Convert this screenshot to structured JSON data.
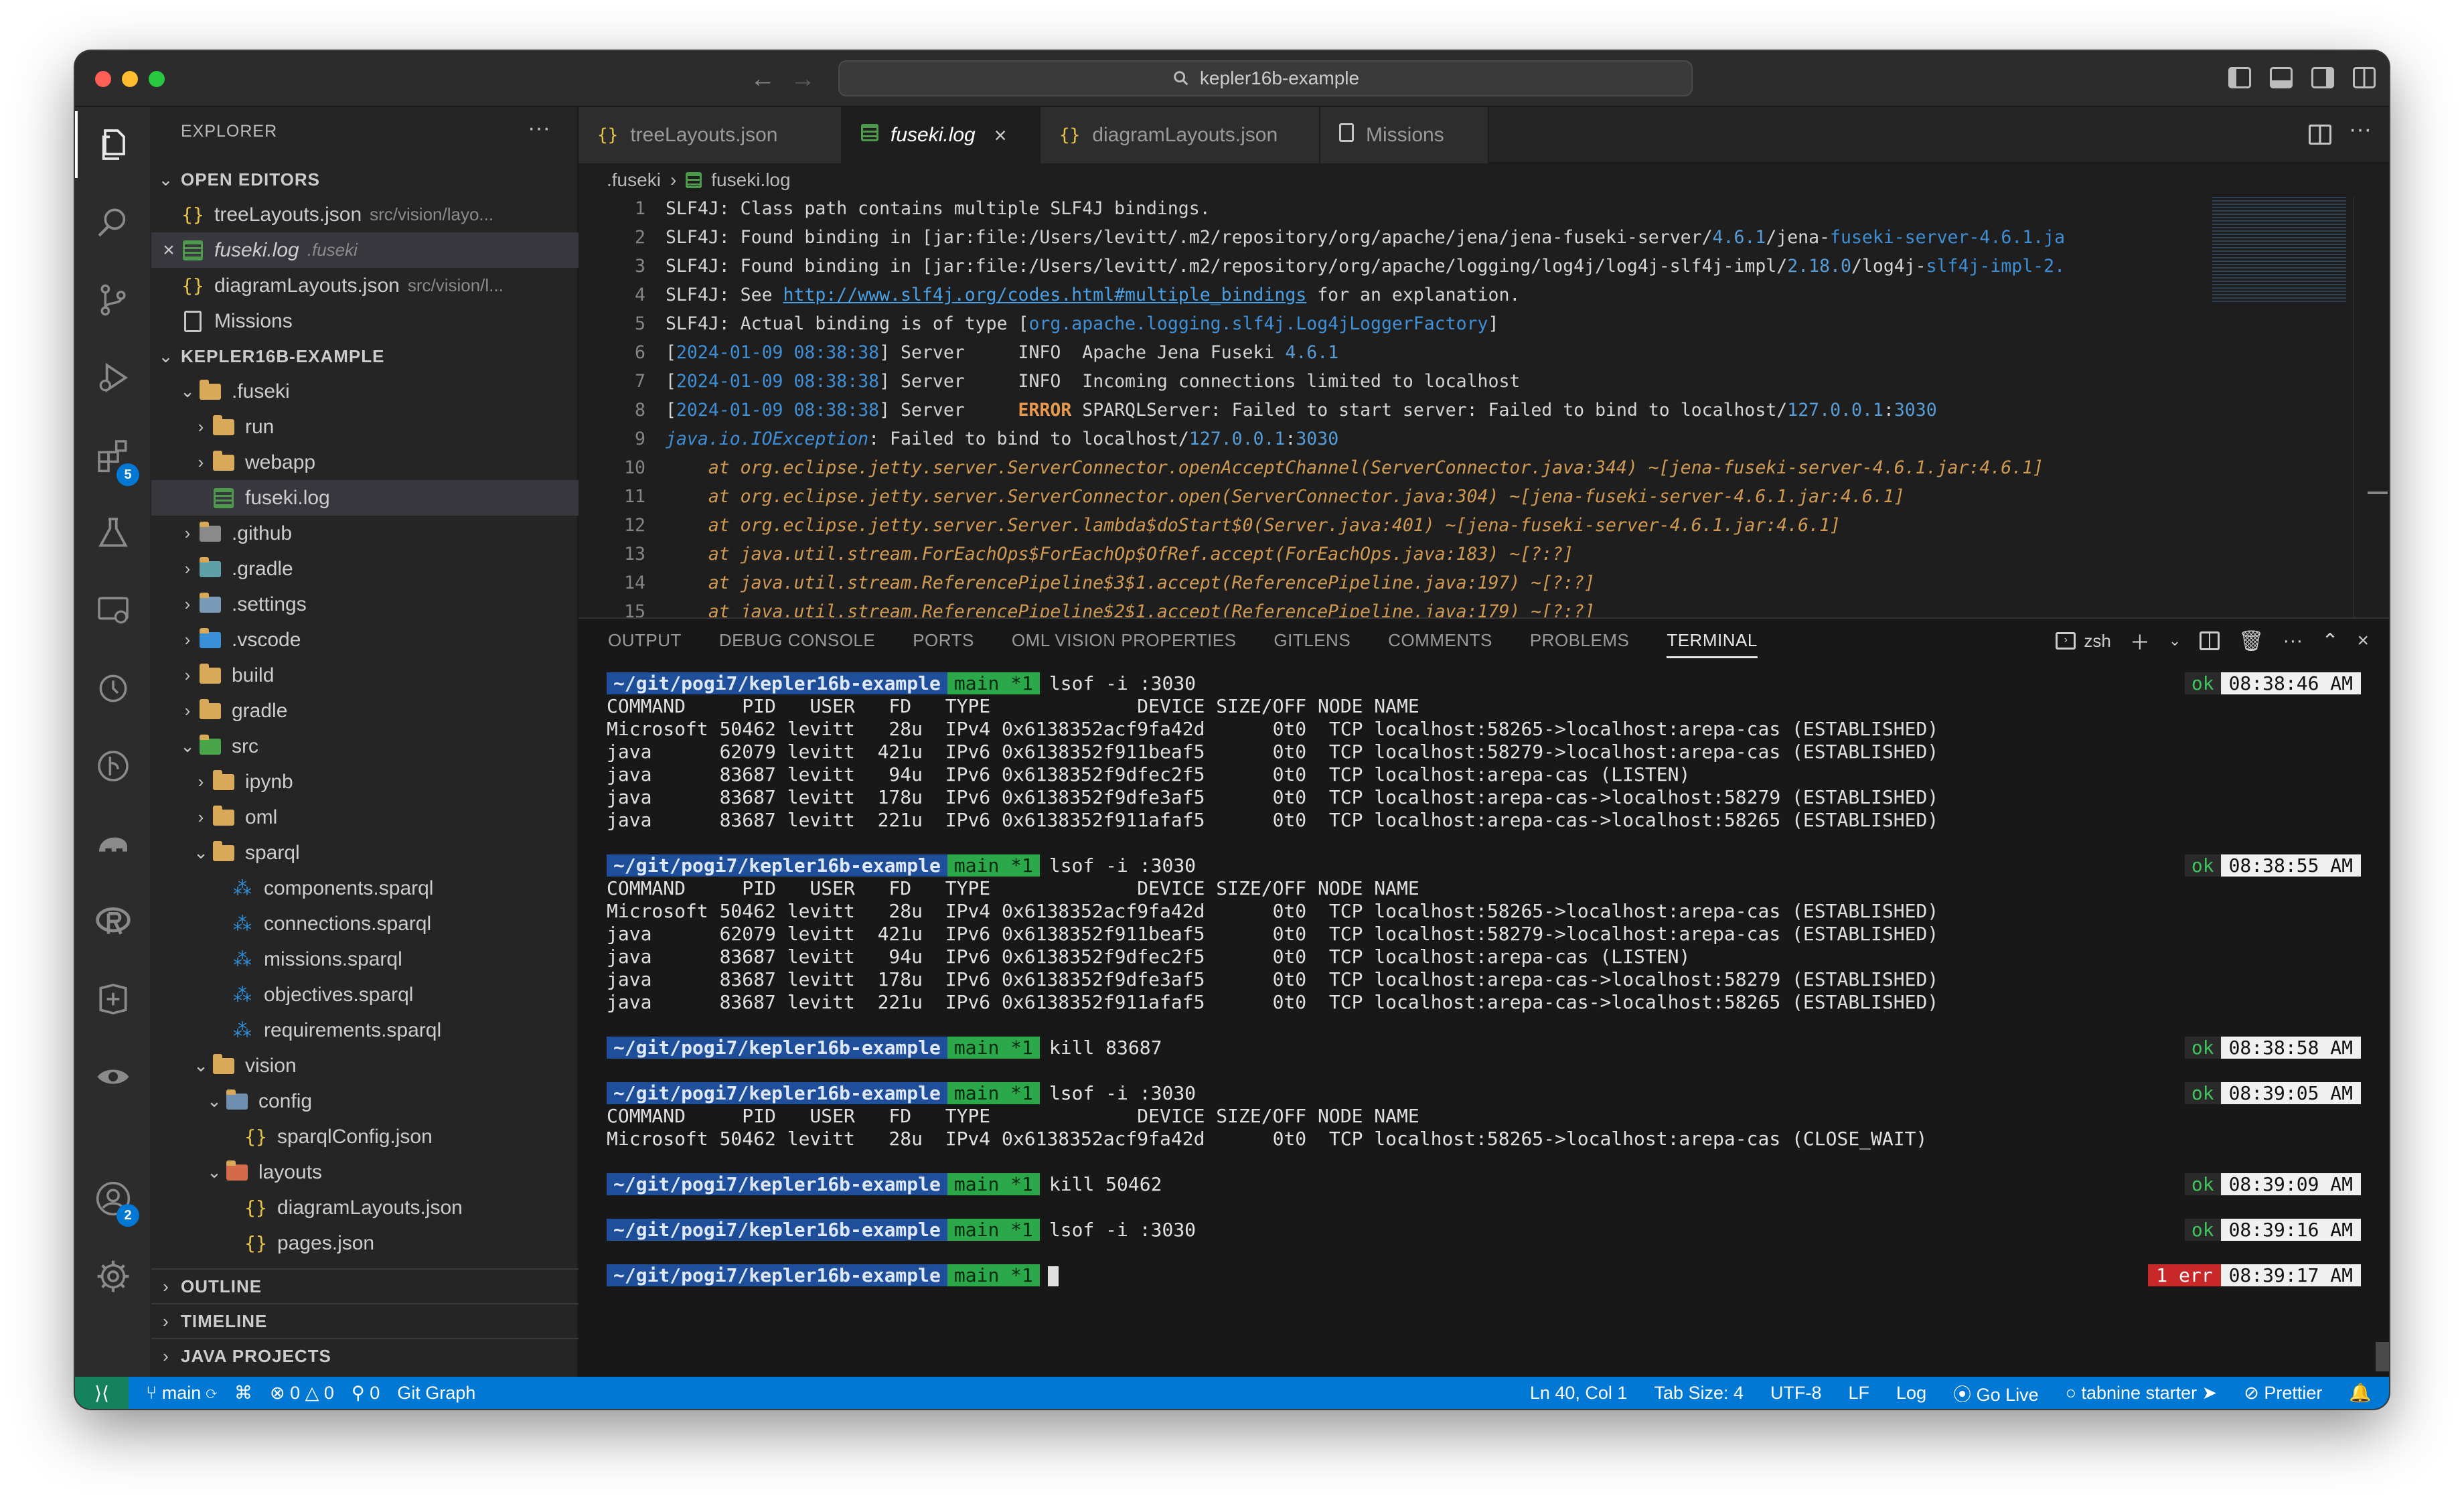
{
  "window": {
    "search_text": "kepler16b-example"
  },
  "activity_bar": {
    "extensions_badge": "5",
    "accounts_badge": "2"
  },
  "explorer": {
    "title": "EXPLORER",
    "open_editors": {
      "label": "OPEN EDITORS",
      "items": [
        {
          "name": "treeLayouts.json",
          "path": "src/vision/layo..."
        },
        {
          "name": "fuseki.log",
          "path": ".fuseki"
        },
        {
          "name": "diagramLayouts.json",
          "path": "src/vision/l..."
        },
        {
          "name": "Missions",
          "path": ""
        }
      ]
    },
    "project": {
      "label": "KEPLER16B-EXAMPLE",
      "items": [
        ".fuseki",
        "run",
        "webapp",
        "fuseki.log",
        ".github",
        ".gradle",
        ".settings",
        ".vscode",
        "build",
        "gradle",
        "src",
        "ipynb",
        "oml",
        "sparql",
        "components.sparql",
        "connections.sparql",
        "missions.sparql",
        "objectives.sparql",
        "requirements.sparql",
        "vision",
        "config",
        "sparqlConfig.json",
        "layouts",
        "diagramLayouts.json",
        "pages.json"
      ]
    },
    "sections": [
      "OUTLINE",
      "TIMELINE",
      "JAVA PROJECTS"
    ]
  },
  "tabs": [
    {
      "label": "treeLayouts.json"
    },
    {
      "label": "fuseki.log"
    },
    {
      "label": "diagramLayouts.json"
    },
    {
      "label": "Missions"
    }
  ],
  "breadcrumb": {
    "folder": ".fuseki",
    "file": "fuseki.log"
  },
  "editor": {
    "line_numbers": [
      "1",
      "2",
      "3",
      "4",
      "5",
      "6",
      "7",
      "8",
      "9",
      "10",
      "11",
      "12",
      "13",
      "14",
      "15"
    ]
  },
  "panel": {
    "tabs": [
      "OUTPUT",
      "DEBUG CONSOLE",
      "PORTS",
      "OML VISION PROPERTIES",
      "GITLENS",
      "COMMENTS",
      "PROBLEMS",
      "TERMINAL"
    ],
    "shell": "zsh"
  },
  "terminal": {
    "path": "~/git/pogi7/kepler16b-example",
    "branch": "main *1",
    "lsof_header": "COMMAND     PID   USER   FD   TYPE             DEVICE SIZE/OFF NODE NAME",
    "lsof_rows": [
      "Microsoft 50462 levitt   28u  IPv4 0x6138352acf9fa42d      0t0  TCP localhost:58265->localhost:arepa-cas (ESTABLISHED)",
      "java      62079 levitt  421u  IPv6 0x6138352f911beaf5      0t0  TCP localhost:58279->localhost:arepa-cas (ESTABLISHED)",
      "java      83687 levitt   94u  IPv6 0x6138352f9dfec2f5      0t0  TCP localhost:arepa-cas (LISTEN)",
      "java      83687 levitt  178u  IPv6 0x6138352f9dfe3af5      0t0  TCP localhost:arepa-cas->localhost:58279 (ESTABLISHED)",
      "java      83687 levitt  221u  IPv6 0x6138352f911afaf5      0t0  TCP localhost:arepa-cas->localhost:58265 (ESTABLISHED)"
    ],
    "close_wait_row": "Microsoft 50462 levitt   28u  IPv4 0x6138352acf9fa42d      0t0  TCP localhost:58265->localhost:arepa-cas (CLOSE_WAIT)",
    "commands": [
      "lsof -i :3030",
      "lsof -i :3030",
      "kill 83687",
      "lsof -i :3030",
      "kill 50462",
      "lsof -i :3030"
    ],
    "ok": "ok",
    "err": "1 err",
    "times": [
      "08:38:46 AM",
      "08:38:55 AM",
      "08:38:58 AM",
      "08:39:05 AM",
      "08:39:09 AM",
      "08:39:16 AM",
      "08:39:17 AM"
    ]
  },
  "status": {
    "branch": "main",
    "problems": "0",
    "warnings": "0",
    "ports": "0",
    "git_graph": "Git Graph",
    "position": "Ln 40, Col 1",
    "tab_size": "Tab Size: 4",
    "encoding": "UTF-8",
    "eol": "LF",
    "language": "Log",
    "go_live": "Go Live",
    "tabnine": "tabnine starter",
    "prettier": "Prettier"
  },
  "colors": {
    "status_bar": "#0078d4",
    "remote": "#16825d",
    "prompt_path": "#1f4f9a",
    "prompt_branch": "#2aa84a",
    "error": "#c82828"
  }
}
